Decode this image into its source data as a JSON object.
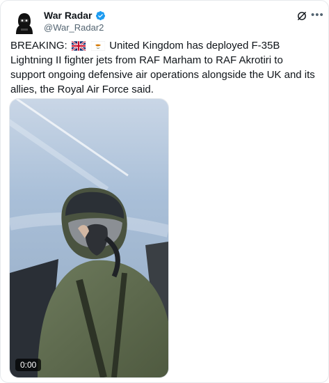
{
  "author": {
    "display_name": "War Radar",
    "handle": "@War_Radar2",
    "verified": true,
    "avatar_icon": "hooded-soldier-avatar"
  },
  "actions": {
    "grok_icon": "grok-icon",
    "more_label": "•••"
  },
  "tweet": {
    "prefix": "BREAKING:",
    "flags": [
      "uk-flag-icon",
      "cyprus-flag-icon"
    ],
    "body": "United Kingdom has deployed F-35B Lightning II fighter jets from RAF Marham to RAF Akrotiri to support ongoing defensive air operations alongside the UK and its allies, the Royal Air Force said."
  },
  "media": {
    "type": "video",
    "subject": "pilot-in-cockpit",
    "timestamp": "0:00"
  },
  "colors": {
    "verified_blue": "#1d9bf0",
    "handle_gray": "#536471",
    "text_dark": "#0f1419",
    "border": "#e6e9ec"
  }
}
